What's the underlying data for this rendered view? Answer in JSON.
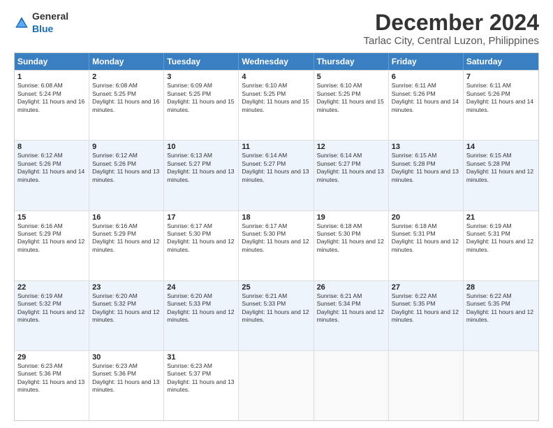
{
  "logo": {
    "general": "General",
    "blue": "Blue"
  },
  "title": "December 2024",
  "location": "Tarlac City, Central Luzon, Philippines",
  "header_days": [
    "Sunday",
    "Monday",
    "Tuesday",
    "Wednesday",
    "Thursday",
    "Friday",
    "Saturday"
  ],
  "weeks": [
    [
      {
        "day": "1",
        "sunrise": "Sunrise: 6:08 AM",
        "sunset": "Sunset: 5:24 PM",
        "daylight": "Daylight: 11 hours and 16 minutes."
      },
      {
        "day": "2",
        "sunrise": "Sunrise: 6:08 AM",
        "sunset": "Sunset: 5:25 PM",
        "daylight": "Daylight: 11 hours and 16 minutes."
      },
      {
        "day": "3",
        "sunrise": "Sunrise: 6:09 AM",
        "sunset": "Sunset: 5:25 PM",
        "daylight": "Daylight: 11 hours and 15 minutes."
      },
      {
        "day": "4",
        "sunrise": "Sunrise: 6:10 AM",
        "sunset": "Sunset: 5:25 PM",
        "daylight": "Daylight: 11 hours and 15 minutes."
      },
      {
        "day": "5",
        "sunrise": "Sunrise: 6:10 AM",
        "sunset": "Sunset: 5:25 PM",
        "daylight": "Daylight: 11 hours and 15 minutes."
      },
      {
        "day": "6",
        "sunrise": "Sunrise: 6:11 AM",
        "sunset": "Sunset: 5:26 PM",
        "daylight": "Daylight: 11 hours and 14 minutes."
      },
      {
        "day": "7",
        "sunrise": "Sunrise: 6:11 AM",
        "sunset": "Sunset: 5:26 PM",
        "daylight": "Daylight: 11 hours and 14 minutes."
      }
    ],
    [
      {
        "day": "8",
        "sunrise": "Sunrise: 6:12 AM",
        "sunset": "Sunset: 5:26 PM",
        "daylight": "Daylight: 11 hours and 14 minutes."
      },
      {
        "day": "9",
        "sunrise": "Sunrise: 6:12 AM",
        "sunset": "Sunset: 5:26 PM",
        "daylight": "Daylight: 11 hours and 13 minutes."
      },
      {
        "day": "10",
        "sunrise": "Sunrise: 6:13 AM",
        "sunset": "Sunset: 5:27 PM",
        "daylight": "Daylight: 11 hours and 13 minutes."
      },
      {
        "day": "11",
        "sunrise": "Sunrise: 6:14 AM",
        "sunset": "Sunset: 5:27 PM",
        "daylight": "Daylight: 11 hours and 13 minutes."
      },
      {
        "day": "12",
        "sunrise": "Sunrise: 6:14 AM",
        "sunset": "Sunset: 5:27 PM",
        "daylight": "Daylight: 11 hours and 13 minutes."
      },
      {
        "day": "13",
        "sunrise": "Sunrise: 6:15 AM",
        "sunset": "Sunset: 5:28 PM",
        "daylight": "Daylight: 11 hours and 13 minutes."
      },
      {
        "day": "14",
        "sunrise": "Sunrise: 6:15 AM",
        "sunset": "Sunset: 5:28 PM",
        "daylight": "Daylight: 11 hours and 12 minutes."
      }
    ],
    [
      {
        "day": "15",
        "sunrise": "Sunrise: 6:16 AM",
        "sunset": "Sunset: 5:29 PM",
        "daylight": "Daylight: 11 hours and 12 minutes."
      },
      {
        "day": "16",
        "sunrise": "Sunrise: 6:16 AM",
        "sunset": "Sunset: 5:29 PM",
        "daylight": "Daylight: 11 hours and 12 minutes."
      },
      {
        "day": "17",
        "sunrise": "Sunrise: 6:17 AM",
        "sunset": "Sunset: 5:30 PM",
        "daylight": "Daylight: 11 hours and 12 minutes."
      },
      {
        "day": "18",
        "sunrise": "Sunrise: 6:17 AM",
        "sunset": "Sunset: 5:30 PM",
        "daylight": "Daylight: 11 hours and 12 minutes."
      },
      {
        "day": "19",
        "sunrise": "Sunrise: 6:18 AM",
        "sunset": "Sunset: 5:30 PM",
        "daylight": "Daylight: 11 hours and 12 minutes."
      },
      {
        "day": "20",
        "sunrise": "Sunrise: 6:18 AM",
        "sunset": "Sunset: 5:31 PM",
        "daylight": "Daylight: 11 hours and 12 minutes."
      },
      {
        "day": "21",
        "sunrise": "Sunrise: 6:19 AM",
        "sunset": "Sunset: 5:31 PM",
        "daylight": "Daylight: 11 hours and 12 minutes."
      }
    ],
    [
      {
        "day": "22",
        "sunrise": "Sunrise: 6:19 AM",
        "sunset": "Sunset: 5:32 PM",
        "daylight": "Daylight: 11 hours and 12 minutes."
      },
      {
        "day": "23",
        "sunrise": "Sunrise: 6:20 AM",
        "sunset": "Sunset: 5:32 PM",
        "daylight": "Daylight: 11 hours and 12 minutes."
      },
      {
        "day": "24",
        "sunrise": "Sunrise: 6:20 AM",
        "sunset": "Sunset: 5:33 PM",
        "daylight": "Daylight: 11 hours and 12 minutes."
      },
      {
        "day": "25",
        "sunrise": "Sunrise: 6:21 AM",
        "sunset": "Sunset: 5:33 PM",
        "daylight": "Daylight: 11 hours and 12 minutes."
      },
      {
        "day": "26",
        "sunrise": "Sunrise: 6:21 AM",
        "sunset": "Sunset: 5:34 PM",
        "daylight": "Daylight: 11 hours and 12 minutes."
      },
      {
        "day": "27",
        "sunrise": "Sunrise: 6:22 AM",
        "sunset": "Sunset: 5:35 PM",
        "daylight": "Daylight: 11 hours and 12 minutes."
      },
      {
        "day": "28",
        "sunrise": "Sunrise: 6:22 AM",
        "sunset": "Sunset: 5:35 PM",
        "daylight": "Daylight: 11 hours and 12 minutes."
      }
    ],
    [
      {
        "day": "29",
        "sunrise": "Sunrise: 6:23 AM",
        "sunset": "Sunset: 5:36 PM",
        "daylight": "Daylight: 11 hours and 13 minutes."
      },
      {
        "day": "30",
        "sunrise": "Sunrise: 6:23 AM",
        "sunset": "Sunset: 5:36 PM",
        "daylight": "Daylight: 11 hours and 13 minutes."
      },
      {
        "day": "31",
        "sunrise": "Sunrise: 6:23 AM",
        "sunset": "Sunset: 5:37 PM",
        "daylight": "Daylight: 11 hours and 13 minutes."
      },
      null,
      null,
      null,
      null
    ]
  ]
}
